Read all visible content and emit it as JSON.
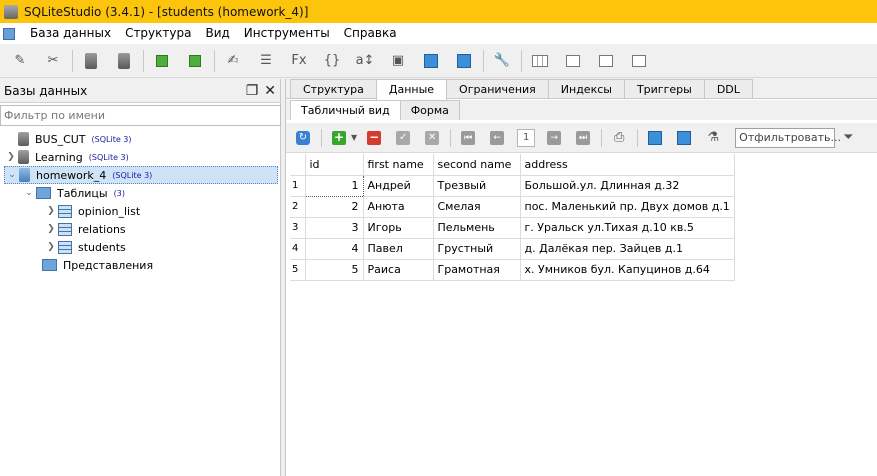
{
  "window": {
    "title": "SQLiteStudio (3.4.1) - [students (homework_4)]"
  },
  "menu": {
    "items": [
      "База данных",
      "Структура",
      "Вид",
      "Инструменты",
      "Справка"
    ]
  },
  "left_panel": {
    "title": "Базы данных",
    "filter_placeholder": "Фильтр по имени",
    "tree": [
      {
        "label": "BUS_CUT",
        "badge": "(SQLite 3)"
      },
      {
        "label": "Learning",
        "badge": "(SQLite 3)"
      },
      {
        "label": "homework_4",
        "badge": "(SQLite 3)"
      },
      {
        "label": "Таблицы",
        "badge": "(3)"
      },
      {
        "label": "opinion_list",
        "badge": ""
      },
      {
        "label": "relations",
        "badge": ""
      },
      {
        "label": "students",
        "badge": ""
      },
      {
        "label": "Представления",
        "badge": ""
      }
    ]
  },
  "tabs": [
    "Структура",
    "Данные",
    "Ограничения",
    "Индексы",
    "Триггеры",
    "DDL"
  ],
  "active_tab": "Данные",
  "subtabs": [
    "Табличный вид",
    "Форма"
  ],
  "active_subtab": "Табличный вид",
  "data_toolbar": {
    "page": "1",
    "filter_placeholder": "Отфильтровать..."
  },
  "grid": {
    "columns": [
      "id",
      "first name",
      "second name",
      "address"
    ],
    "rows": [
      {
        "n": "1",
        "id": "1",
        "first_name": "Андрей",
        "second_name": "Трезвый",
        "address": "Большой.ул. Длинная д.32"
      },
      {
        "n": "2",
        "id": "2",
        "first_name": "Анюта",
        "second_name": "Смелая",
        "address": "пос. Маленький пр. Двух домов д.1"
      },
      {
        "n": "3",
        "id": "3",
        "first_name": "Игорь",
        "second_name": "Пельмень",
        "address": "г. Уральск ул.Тихая д.10 кв.5"
      },
      {
        "n": "4",
        "id": "4",
        "first_name": "Павел",
        "second_name": "Грустный",
        "address": "д. Далёкая пер. Зайцев д.1"
      },
      {
        "n": "5",
        "id": "5",
        "first_name": "Раиса",
        "second_name": "Грамотная",
        "address": "х. Умников бул. Капуцинов д.64"
      }
    ]
  }
}
